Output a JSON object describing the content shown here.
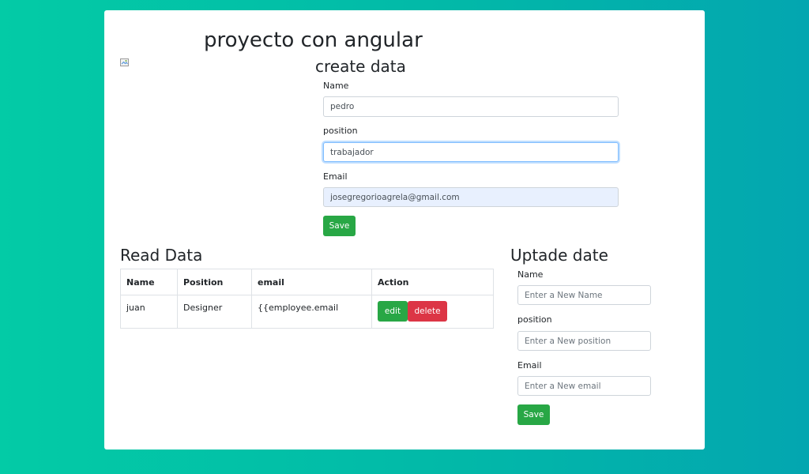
{
  "header": {
    "title": "proyecto con angular"
  },
  "create_form": {
    "title": "create data",
    "name_label": "Name",
    "name_value": "pedro",
    "position_label": "position",
    "position_value": "trabajador",
    "email_label": "Email",
    "email_value": "josegregorioagrela@gmail.com",
    "save_label": "Save"
  },
  "read_section": {
    "title": "Read Data",
    "columns": [
      "Name",
      "Position",
      "email",
      "Action"
    ],
    "rows": [
      {
        "name": "juan",
        "position": "Designer",
        "email": "{{employee.email",
        "edit_label": "edit",
        "delete_label": "delete"
      }
    ]
  },
  "update_form": {
    "title": "Uptade date",
    "name_label": "Name",
    "name_placeholder": "Enter a New Name",
    "position_label": "position",
    "position_placeholder": "Enter a New position",
    "email_label": "Email",
    "email_placeholder": "Enter a New email",
    "save_label": "Save"
  },
  "colors": {
    "background_start": "#03cba6",
    "background_end": "#03a6b0",
    "success": "#28a745",
    "danger": "#dc3545",
    "focus": "#80bdff",
    "autofill": "#e8f0fe"
  },
  "icons": {
    "broken_image": "broken-image-icon"
  }
}
